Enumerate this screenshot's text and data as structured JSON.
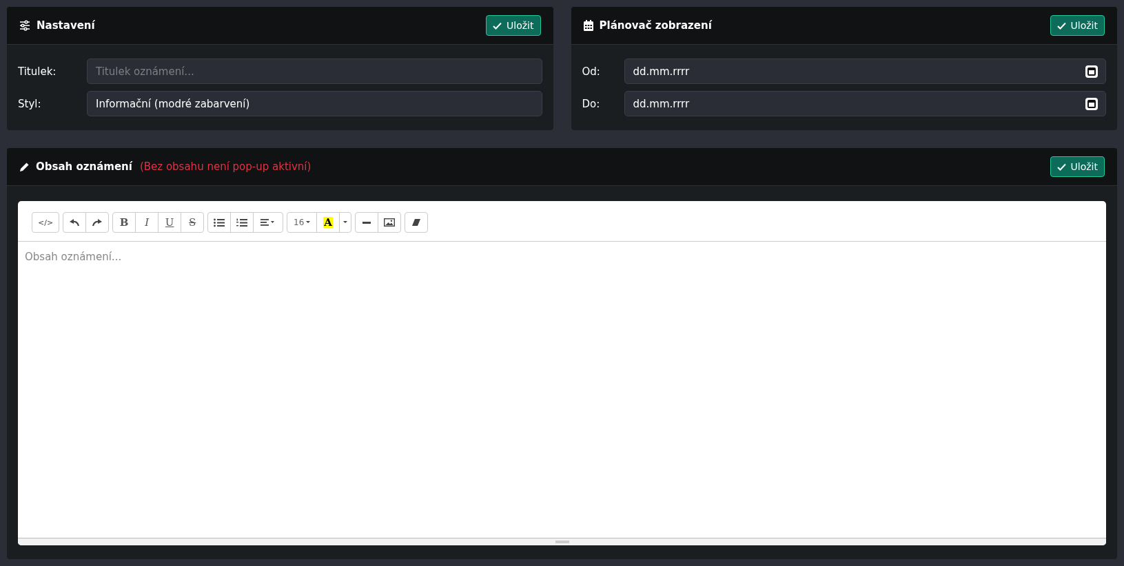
{
  "settings": {
    "title": "Nastavení",
    "save_button": "Uložit",
    "fields": [
      {
        "label": "Titulek:",
        "placeholder": "Titulek oznámení..."
      },
      {
        "label": "Styl:",
        "value": "Informační (modré zabarvení)"
      }
    ]
  },
  "scheduler": {
    "title": "Plánovač zobrazení",
    "save_button": "Uložit",
    "fields": [
      {
        "label": "Od:",
        "value": "dd.mm.rrrr"
      },
      {
        "label": "Do:",
        "value": "dd.mm.rrrr"
      }
    ]
  },
  "content": {
    "title": "Obsah oznámení",
    "note": "(Bez obsahu není pop-up aktivní)",
    "save_button": "Uložit",
    "editor": {
      "placeholder": "Obsah oznámení...",
      "toolbar": [
        [
          {
            "kind": "code",
            "label": "</>"
          }
        ],
        [
          {
            "kind": "undo"
          },
          {
            "kind": "redo"
          }
        ],
        [
          {
            "kind": "bold",
            "label": "B"
          },
          {
            "kind": "italic",
            "label": "I"
          },
          {
            "kind": "underline",
            "label": "U"
          },
          {
            "kind": "strike",
            "label": "S"
          }
        ],
        [
          {
            "kind": "bullet-list"
          },
          {
            "kind": "numbered-list"
          },
          {
            "kind": "align"
          }
        ],
        [
          {
            "kind": "font-size",
            "label": "16"
          },
          {
            "kind": "color",
            "label": "A"
          },
          {
            "kind": "caret"
          }
        ],
        [
          {
            "kind": "rule"
          },
          {
            "kind": "image"
          }
        ],
        [
          {
            "kind": "eraser"
          }
        ]
      ]
    }
  }
}
